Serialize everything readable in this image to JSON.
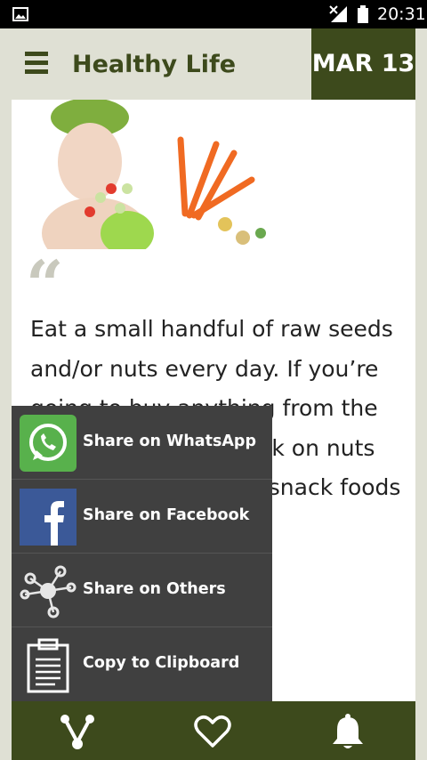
{
  "status_bar": {
    "time": "20:31"
  },
  "header": {
    "title": "Healthy Life",
    "date": "MAR 13"
  },
  "tip": {
    "quote_mark": "“",
    "text": "Eat a small handful of raw seeds and/or nuts every day. If you’re going to buy anything from the store, make it to snack on nuts and seeds instead of snack foods like the chips"
  },
  "share_menu": [
    {
      "label": "Share on WhatsApp",
      "icon": "whatsapp-icon"
    },
    {
      "label": "Share on Facebook",
      "icon": "facebook-icon"
    },
    {
      "label": "Share on Others",
      "icon": "share-network-icon"
    },
    {
      "label": "Copy to Clipboard",
      "icon": "clipboard-icon"
    }
  ],
  "bottom_nav": [
    {
      "icon": "share-icon"
    },
    {
      "icon": "heart-icon"
    },
    {
      "icon": "bell-icon"
    }
  ],
  "colors": {
    "brand_dark": "#3d4a1c",
    "background": "#dfe0d4",
    "sheet": "#404040"
  }
}
